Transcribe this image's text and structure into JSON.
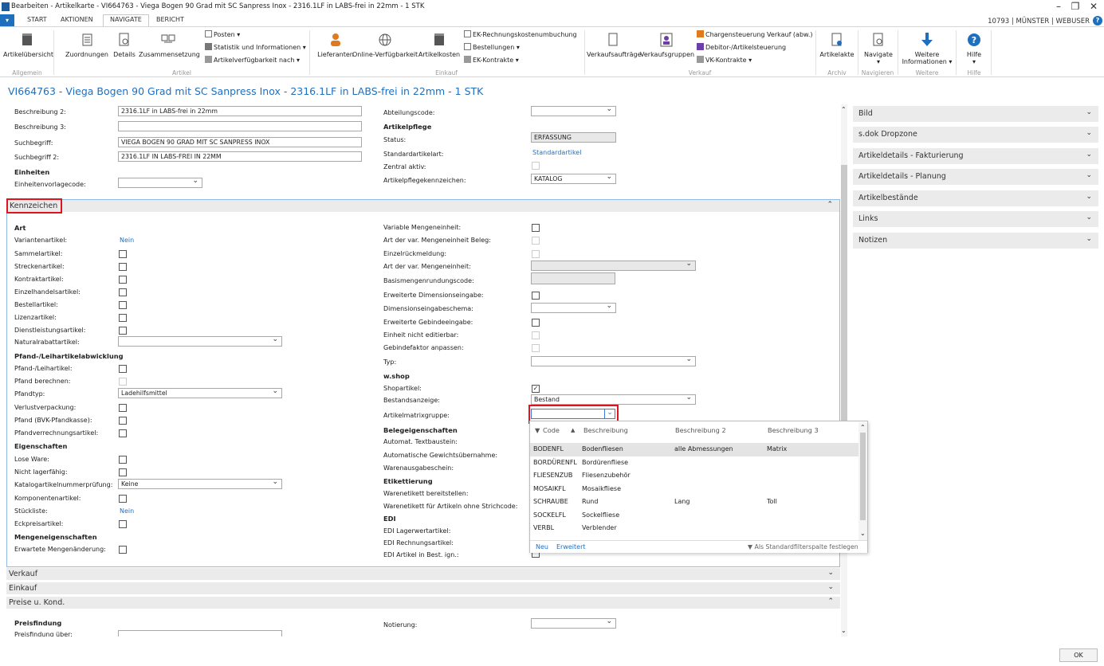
{
  "window": {
    "title": "Bearbeiten - Artikelkarte - VI664763 - Viega Bogen 90 Grad mit SC Sanpress Inox - 2316.1LF in LABS-frei in 22mm - 1 STK",
    "minimize": "–",
    "restore": "❐",
    "close": "✕"
  },
  "tabs": [
    "START",
    "AKTIONEN",
    "NAVIGATE",
    "BERICHT"
  ],
  "status": "10793 | MÜNSTER | WEBUSER",
  "ribbon": {
    "artikeluebersicht": "Artikelübersicht",
    "zuordnungen": "Zuordnungen",
    "details": "Details",
    "zusammensetzung": "Zusammensetzung",
    "posten": "Posten ▾",
    "statistik": "Statistik und Informationen ▾",
    "verfuegbarkeit": "Artikelverfügbarkeit nach ▾",
    "lieferanten": "Lieferanten",
    "online": "Online-Verfügbarkeit",
    "artikelkosten": "Artikelkosten",
    "ek_rechnung": "EK-Rechnungskostenumbuchung",
    "bestellungen": "Bestellungen ▾",
    "ek_kontrakte": "EK-Kontrakte ▾",
    "verkaufsauftraege": "Verkaufsaufträge",
    "verkaufsgruppen": "Verkaufsgruppen",
    "chargen": "Chargensteuerung Verkauf (abw.)",
    "debitor": "Debitor-/Artikelsteuerung",
    "vk_kontrakte": "VK-Kontrakte ▾",
    "artikelakte": "Artikelakte",
    "navigate": "Navigate",
    "weitere": "Weitere",
    "informationen": "Informationen ▾",
    "hilfe": "Hilfe",
    "groups": [
      "Allgemein",
      "Artikel",
      "Einkauf",
      "Verkauf",
      "Archiv",
      "Navigieren",
      "Weitere",
      "Hilfe"
    ]
  },
  "page_title": "VI664763 - Viega Bogen 90 Grad mit SC Sanpress Inox - 2316.1LF in LABS-frei in 22mm - 1 STK",
  "top": {
    "beschreibung2_label": "Beschreibung 2:",
    "beschreibung2": "2316.1LF in LABS-frei in 22mm",
    "beschreibung3_label": "Beschreibung 3:",
    "beschreibung3": "",
    "suchbegriff_label": "Suchbegriff:",
    "suchbegriff": "VIEGA BOGEN 90 GRAD MIT SC SANPRESS INOX",
    "suchbegriff2_label": "Suchbegriff 2:",
    "suchbegriff2": "2316.1LF IN LABS-FREI IN 22MM",
    "einheiten": "Einheiten",
    "einheitenvorlage_label": "Einheitenvorlagecode:",
    "abteilung_label": "Abteilungscode:",
    "artikelpflege": "Artikelpflege",
    "status_label": "Status:",
    "status": "ERFASSUNG",
    "standardart_label": "Standardartikelart:",
    "standardart": "Standardartikel",
    "zentral_label": "Zentral aktiv:",
    "pflegekz_label": "Artikelpflegekennzeichen:",
    "pflegekz": "KATALOG"
  },
  "kennzeichen": {
    "header": "Kennzeichen",
    "left": [
      {
        "t": "Art",
        "kind": "head"
      },
      {
        "t": "Variantenartikel:",
        "kind": "link",
        "v": "Nein"
      },
      {
        "t": "Sammelartikel:",
        "kind": "cb"
      },
      {
        "t": "Streckenartikel:",
        "kind": "cb"
      },
      {
        "t": "Kontraktartikel:",
        "kind": "cb"
      },
      {
        "t": "Einzelhandelsartikel:",
        "kind": "cb"
      },
      {
        "t": "Bestellartikel:",
        "kind": "cb"
      },
      {
        "t": "Lizenzartikel:",
        "kind": "cb"
      },
      {
        "t": "Dienstleistungsartikel:",
        "kind": "cb"
      },
      {
        "t": "Naturalrabattartikel:",
        "kind": "dd",
        "v": ""
      },
      {
        "t": "Pfand-/Leihartikelabwicklung",
        "kind": "head"
      },
      {
        "t": "Pfand-/Leihartikel:",
        "kind": "cb"
      },
      {
        "t": "Pfand berechnen:",
        "kind": "cbdis"
      },
      {
        "t": "Pfandtyp:",
        "kind": "dd",
        "v": "Ladehilfsmittel"
      },
      {
        "t": "Verlustverpackung:",
        "kind": "cb"
      },
      {
        "t": "Pfand (BVK-Pfandkasse):",
        "kind": "cb"
      },
      {
        "t": "Pfandverrechnungsartikel:",
        "kind": "cb"
      },
      {
        "t": "Eigenschaften",
        "kind": "head"
      },
      {
        "t": "Lose Ware:",
        "kind": "cb"
      },
      {
        "t": "Nicht lagerfähig:",
        "kind": "cb"
      },
      {
        "t": "Katalogartikelnummerprüfung:",
        "kind": "dd",
        "v": "Keine"
      },
      {
        "t": "Komponentenartikel:",
        "kind": "cb"
      },
      {
        "t": "Stückliste:",
        "kind": "link",
        "v": "Nein"
      },
      {
        "t": "Eckpreisartikel:",
        "kind": "cb"
      },
      {
        "t": "Mengeneigenschaften",
        "kind": "head"
      },
      {
        "t": "Erwartete Mengenänderung:",
        "kind": "cb"
      }
    ],
    "right": [
      {
        "t": "Variable Mengeneinheit:",
        "kind": "cb"
      },
      {
        "t": "Art der var. Mengeneinheit Beleg:",
        "kind": "cbdis"
      },
      {
        "t": "Einzelrückmeldung:",
        "kind": "cbdis"
      },
      {
        "t": "Art der var. Mengeneinheit:",
        "kind": "ddro",
        "v": ""
      },
      {
        "t": "Basismengenrundungscode:",
        "kind": "ro",
        "v": ""
      },
      {
        "t": "Erweiterte Dimensionseingabe:",
        "kind": "cb"
      },
      {
        "t": "Dimensionseingabeschema:",
        "kind": "ddshort",
        "v": ""
      },
      {
        "t": "Erweiterte Gebindeeingabe:",
        "kind": "cb"
      },
      {
        "t": "Einheit nicht editierbar:",
        "kind": "cbdis"
      },
      {
        "t": "Gebindefaktor anpassen:",
        "kind": "cbdis"
      },
      {
        "t": "Typ:",
        "kind": "dd",
        "v": ""
      },
      {
        "t": "w.shop",
        "kind": "head"
      },
      {
        "t": "Shopartikel:",
        "kind": "cbchk"
      },
      {
        "t": "Bestandsanzeige:",
        "kind": "dd",
        "v": "Bestand"
      },
      {
        "t": "Artikelmatrixgruppe:",
        "kind": "matrix",
        "v": ""
      },
      {
        "t": "Belegeigenschaften",
        "kind": "head"
      },
      {
        "t": "Automat. Textbaustein:",
        "kind": "none"
      },
      {
        "t": "Automatische Gewichtsübernahme:",
        "kind": "none"
      },
      {
        "t": "Warenausgabeschein:",
        "kind": "none"
      },
      {
        "t": "Etikettierung",
        "kind": "head"
      },
      {
        "t": "Warenetikett bereitstellen:",
        "kind": "none"
      },
      {
        "t": "Warenetikett für Artikeln ohne Strichcode:",
        "kind": "none"
      },
      {
        "t": "EDI",
        "kind": "head"
      },
      {
        "t": "EDI Lagerwertartikel:",
        "kind": "none"
      },
      {
        "t": "EDI Rechnungsartikel:",
        "kind": "none"
      },
      {
        "t": "EDI Artikel in Best. ign.:",
        "kind": "none"
      }
    ]
  },
  "sections": {
    "verkauf": "Verkauf",
    "einkauf": "Einkauf",
    "preise": "Preise u. Kond.",
    "preisfindung": "Preisfindung",
    "preisfindung_ueber": "Preisfindung über:",
    "notierung": "Notierung:"
  },
  "side": [
    "Bild",
    "s.dok Dropzone",
    "Artikeldetails - Fakturierung",
    "Artikeldetails - Planung",
    "Artikelbestände",
    "Links",
    "Notizen"
  ],
  "dropdown": {
    "headers": [
      "Code",
      "Beschreibung",
      "Beschreibung 2",
      "Beschreibung 3"
    ],
    "rows": [
      [
        "BODENFL",
        "Bodenfliesen",
        "alle Abmessungen",
        "Matrix"
      ],
      [
        "BORDÜRENFL",
        "Bordürenfliese",
        "",
        ""
      ],
      [
        "FLIESENZUB",
        "Fliesenzubehör",
        "",
        ""
      ],
      [
        "MOSAIKFL",
        "Mosaikfliese",
        "",
        ""
      ],
      [
        "SCHRAUBE",
        "Rund",
        "Lang",
        "Toll"
      ],
      [
        "SOCKELFL",
        "Sockelfliese",
        "",
        ""
      ],
      [
        "VERBL",
        "Verblender",
        "",
        ""
      ]
    ],
    "neu": "Neu",
    "erweitert": "Erweitert",
    "filter": "Als Standardfilterspalte festlegen"
  },
  "ok": "OK"
}
